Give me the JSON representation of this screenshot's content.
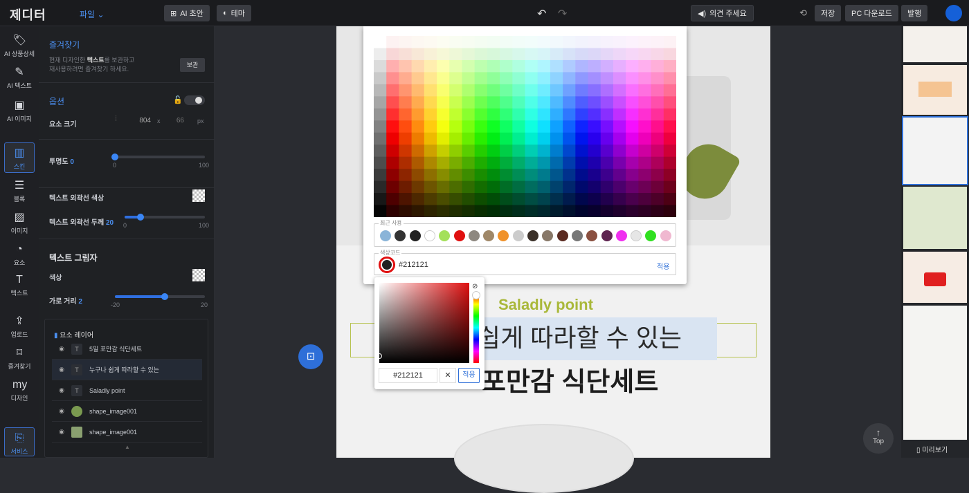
{
  "app": {
    "logo": "제디터",
    "file_menu": "파일"
  },
  "toolbar": {
    "ai_draft": "AI 초안",
    "theme": "테마",
    "feedback": "의견 주세요",
    "save": "저장",
    "pc_download": "PC 다운로드",
    "publish": "발행"
  },
  "rail": [
    {
      "label": "AI 상품상세",
      "icon": "tag-sparkle-icon"
    },
    {
      "label": "AI 텍스트",
      "icon": "pen-sparkle-icon"
    },
    {
      "label": "AI 이미지",
      "icon": "image-sparkle-icon"
    },
    {
      "label": "스킨",
      "icon": "layout-icon"
    },
    {
      "label": "블록",
      "icon": "block-icon"
    },
    {
      "label": "이미지",
      "icon": "image-icon"
    },
    {
      "label": "요소",
      "icon": "shapes-icon"
    },
    {
      "label": "텍스트",
      "icon": "text-icon"
    },
    {
      "label": "업로드",
      "icon": "upload-icon"
    },
    {
      "label": "즐겨찾기",
      "icon": "bookmark-icon"
    },
    {
      "label": "디자인",
      "icon": "my-design-icon"
    },
    {
      "label": "서비스",
      "icon": "service-icon"
    }
  ],
  "panel": {
    "fav_title": "즐겨찾기",
    "fav_desc_1": "현재 디자인한 ",
    "fav_desc_bold": "텍스트",
    "fav_desc_2": "를 보관하고",
    "fav_desc_3": "재사용하려면 즐겨찾기 하세요.",
    "fav_btn": "보관",
    "options_title": "옵션",
    "size_label": "요소 크기",
    "width": "804",
    "x": "x",
    "height": "66",
    "unit": "px",
    "opacity_label": "투명도",
    "opacity_value": "0",
    "opacity_min": "0",
    "opacity_max": "100",
    "opacity_fraction": 0.0,
    "stroke_color_label": "텍스트 외곽선 색상",
    "stroke_width_label": "텍스트 외곽선 두께",
    "stroke_width_value": "20",
    "stroke_min": "0",
    "stroke_max": "100",
    "stroke_fraction": 0.2,
    "shadow_title": "텍스트 그림자",
    "shadow_color_label": "색상",
    "shadow_dist_label": "가로 거리",
    "shadow_dist_value": "2",
    "shadow_min": "-20",
    "shadow_max": "20",
    "shadow_fraction": 0.55,
    "layers_title": "요소 레이어",
    "layers": [
      {
        "type": "T",
        "name": "5일 포만감 식단세트"
      },
      {
        "type": "T",
        "name": "누구나 쉽게 따라할 수 있는"
      },
      {
        "type": "T",
        "name": "Saladly point"
      },
      {
        "type": "img",
        "name": "shape_image001"
      },
      {
        "type": "img",
        "name": "shape_image001"
      }
    ]
  },
  "canvas": {
    "saladly": "Saladly point",
    "line1": "쉽게 따라할 수 있는",
    "line2": "포만감 식단세트",
    "top_label": "Top",
    "preview_label": "미리보기"
  },
  "picker": {
    "recent_label": "최근 사용",
    "recent": [
      "#8ab4d8",
      "#333333",
      "#212121",
      "#ffffff",
      "#a4e05a",
      "#e01010",
      "#8e8880",
      "#a08868",
      "#f0922a",
      "#cccccc",
      "#3a3028",
      "#887868",
      "#5a2a20",
      "#777777",
      "#8a5040",
      "#5e2450",
      "#f030f0",
      "#e6e6e6",
      "#30e020",
      "#f0b8d0"
    ],
    "code_label": "색상코드",
    "code_value": "#212121",
    "apply": "적용",
    "hex_value": "#212121",
    "apply2": "적용",
    "colors": {
      "accent": "#4b8ff0"
    }
  }
}
